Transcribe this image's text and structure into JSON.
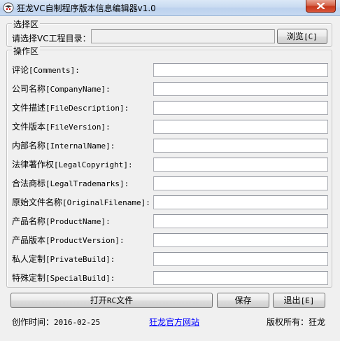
{
  "window": {
    "title": "狂龙VC自制程序版本信息编辑器v1.0"
  },
  "select_group": {
    "legend": "选择区",
    "project_dir_label": "请选择VC工程目录：",
    "project_dir_value": "",
    "browse_label_main": "浏览",
    "browse_label_key": "[C]"
  },
  "operate_group": {
    "legend": "操作区",
    "fields": [
      {
        "cn": "评论",
        "en": "[Comments]:",
        "value": ""
      },
      {
        "cn": "公司名称",
        "en": "[CompanyName]:",
        "value": ""
      },
      {
        "cn": "文件描述",
        "en": "[FileDescription]:",
        "value": ""
      },
      {
        "cn": "文件版本",
        "en": "[FileVersion]:",
        "value": ""
      },
      {
        "cn": "内部名称",
        "en": "[InternalName]:",
        "value": ""
      },
      {
        "cn": "法律著作权",
        "en": "[LegalCopyright]:",
        "value": ""
      },
      {
        "cn": "合法商标",
        "en": "[LegalTrademarks]:",
        "value": ""
      },
      {
        "cn": "原始文件名称",
        "en": "[OriginalFilename]:",
        "value": ""
      },
      {
        "cn": "产品名称",
        "en": "[ProductName]:",
        "value": ""
      },
      {
        "cn": "产品版本",
        "en": "[ProductVersion]:",
        "value": ""
      },
      {
        "cn": "私人定制",
        "en": "[PrivateBuild]:",
        "value": ""
      },
      {
        "cn": "特殊定制",
        "en": "[SpecialBuild]:",
        "value": ""
      }
    ]
  },
  "buttons": {
    "open_rc_main": "打开",
    "open_rc_mid": "RC",
    "open_rc_tail": "文件",
    "save": "保存",
    "exit_main": "退出",
    "exit_key": "[E]"
  },
  "footer": {
    "created_label": "创作时间：",
    "created_date": "2016-02-25",
    "website_link": "狂龙官方网站",
    "copyright_label": "版权所有：",
    "copyright_owner": "狂龙"
  }
}
